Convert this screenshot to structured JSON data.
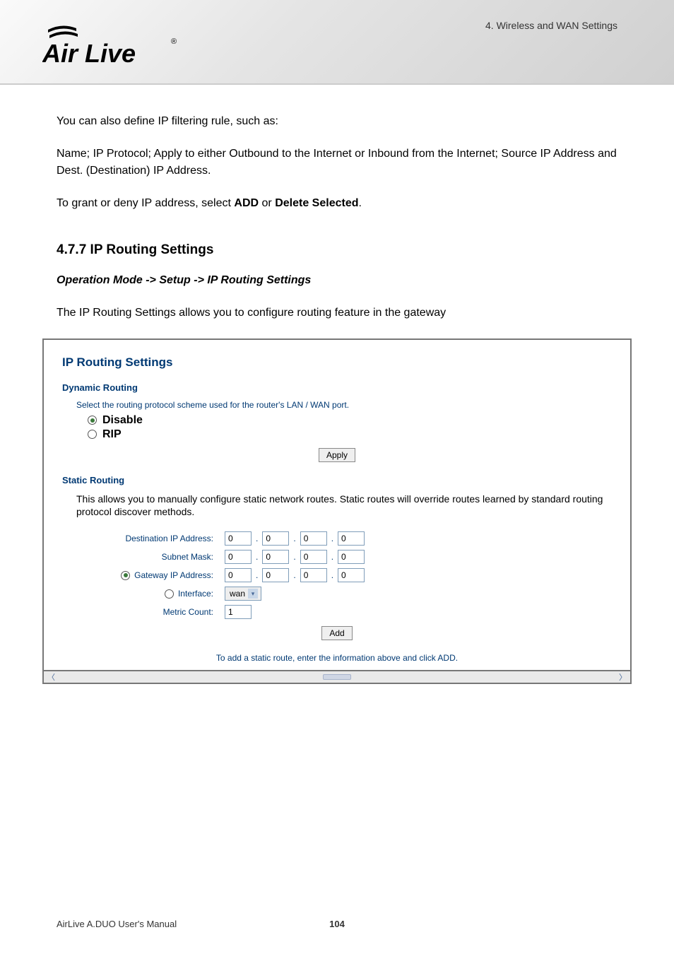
{
  "header": {
    "breadcrumb": "4. Wireless and WAN Settings",
    "logo_text": "Air Live",
    "logo_reg": "®"
  },
  "body": {
    "intro": "You can also define IP filtering rule, such as:",
    "para2_prefix": "Name; IP Protocol; Apply to either Outbound to the Internet or Inbound from the Internet; Source IP Address and Dest. (Destination) IP Address.",
    "para3_prefix": "To grant or deny IP address, select ",
    "para3_add": "ADD",
    "para3_mid": " or ",
    "para3_del": "Delete Selected",
    "para3_suffix": ".",
    "section_title": "4.7.7 IP Routing Settings",
    "op_mode": "Operation Mode -> Setup -> IP Routing Settings",
    "section_desc": "The IP Routing Settings allows you to configure routing feature in the gateway"
  },
  "panel": {
    "title": "IP Routing Settings",
    "dynamic_title": "Dynamic Routing",
    "dynamic_help": "Select the routing protocol scheme used for the router's LAN / WAN port.",
    "radio_disable": "Disable",
    "radio_rip": "RIP",
    "apply_btn": "Apply",
    "static_title": "Static Routing",
    "static_desc": "This allows you to manually configure static network routes. Static routes will override routes learned by standard routing protocol discover methods.",
    "fields": {
      "dest_label": "Destination IP Address:",
      "dest_values": [
        "0",
        "0",
        "0",
        "0"
      ],
      "subnet_label": "Subnet Mask:",
      "subnet_values": [
        "0",
        "0",
        "0",
        "0"
      ],
      "gateway_label": "Gateway IP Address:",
      "gateway_values": [
        "0",
        "0",
        "0",
        "0"
      ],
      "interface_label": "Interface:",
      "interface_value": "wan",
      "metric_label": "Metric Count:",
      "metric_value": "1"
    },
    "add_btn": "Add",
    "add_note": "To add a static route, enter the information above and click ADD."
  },
  "footer": {
    "manual": "AirLive A.DUO User's Manual",
    "page_num": "104"
  }
}
